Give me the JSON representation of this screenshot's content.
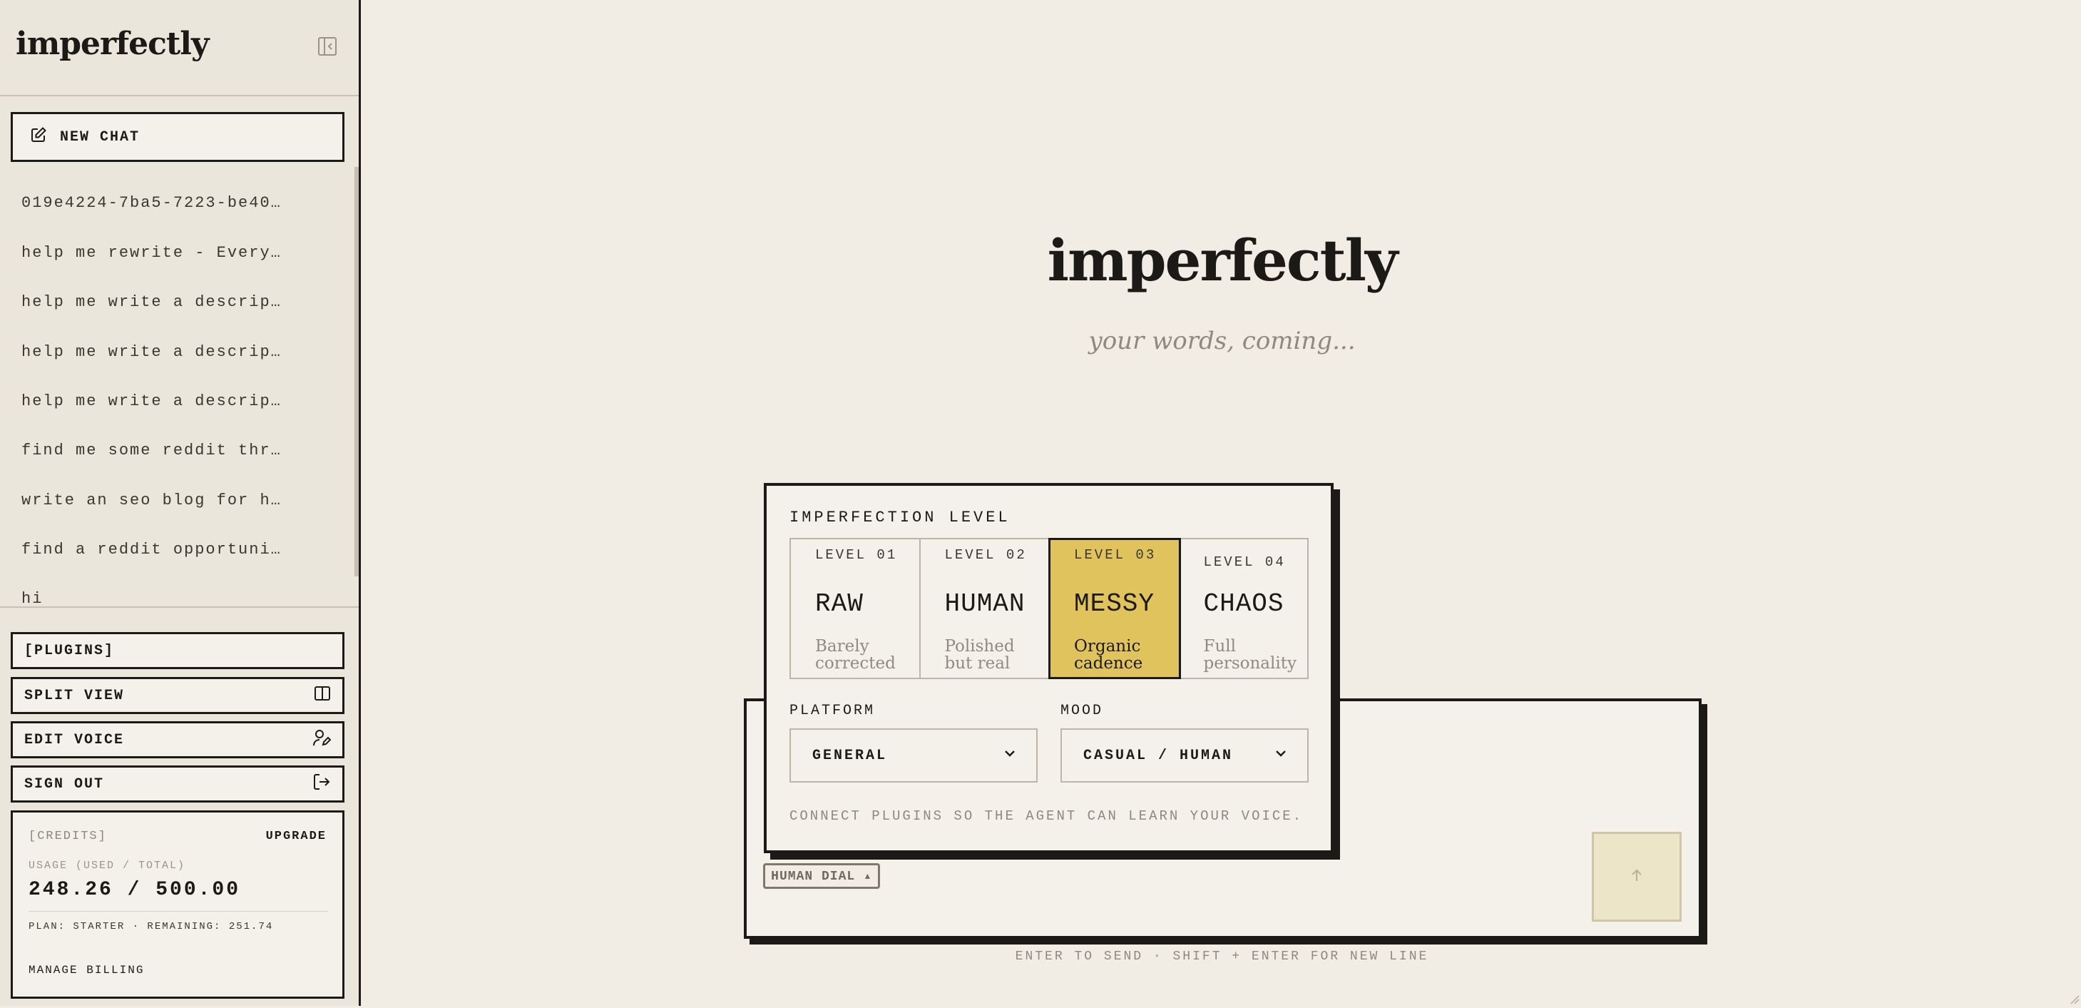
{
  "sidebar": {
    "logo": "imperfectly",
    "new_chat_label": "NEW CHAT",
    "history": [
      "019e4224-7ba5-7223-be40…",
      "help me rewrite - Every…",
      "help me write a descrip…",
      "help me write a descrip…",
      "help me write a descrip…",
      "find me some reddit thr…",
      "write an seo blog for h…",
      "find a reddit opportuni…",
      "hi"
    ],
    "plugins_label": "[PLUGINS]",
    "split_view_label": "SPLIT VIEW",
    "edit_voice_label": "EDIT VOICE",
    "sign_out_label": "SIGN OUT",
    "credits": {
      "label": "[CREDITS]",
      "upgrade_label": "UPGRADE",
      "usage_label": "USAGE (USED / TOTAL)",
      "usage_value": "248.26 / 500.00",
      "plan_line": "PLAN: STARTER · REMAINING: 251.74",
      "billing_label": "MANAGE BILLING"
    }
  },
  "main": {
    "title": "imperfectly",
    "subtitle": "your words, coming...",
    "human_dial_label": "HUMAN DIAL ▴",
    "hint": "ENTER TO SEND · SHIFT + ENTER FOR NEW LINE"
  },
  "popover": {
    "heading": "IMPERFECTION LEVEL",
    "levels": [
      {
        "tag": "LEVEL 01",
        "name": "RAW",
        "desc": "Barely corrected",
        "active": false
      },
      {
        "tag": "LEVEL 02",
        "name": "HUMAN",
        "desc": "Polished but real",
        "active": false
      },
      {
        "tag": "LEVEL 03",
        "name": "MESSY",
        "desc": "Organic cadence",
        "active": true
      },
      {
        "tag": "LEVEL 04",
        "name": "CHAOS",
        "desc": "Full personality",
        "active": false
      }
    ],
    "platform_label": "PLATFORM",
    "platform_value": "GENERAL",
    "mood_label": "MOOD",
    "mood_value": "CASUAL / HUMAN",
    "note": "CONNECT PLUGINS SO THE AGENT CAN LEARN YOUR VOICE."
  },
  "colors": {
    "background": "#f1ede5",
    "ink": "#1c1a17",
    "accent": "#e0c35d",
    "muted": "#8f897d"
  }
}
